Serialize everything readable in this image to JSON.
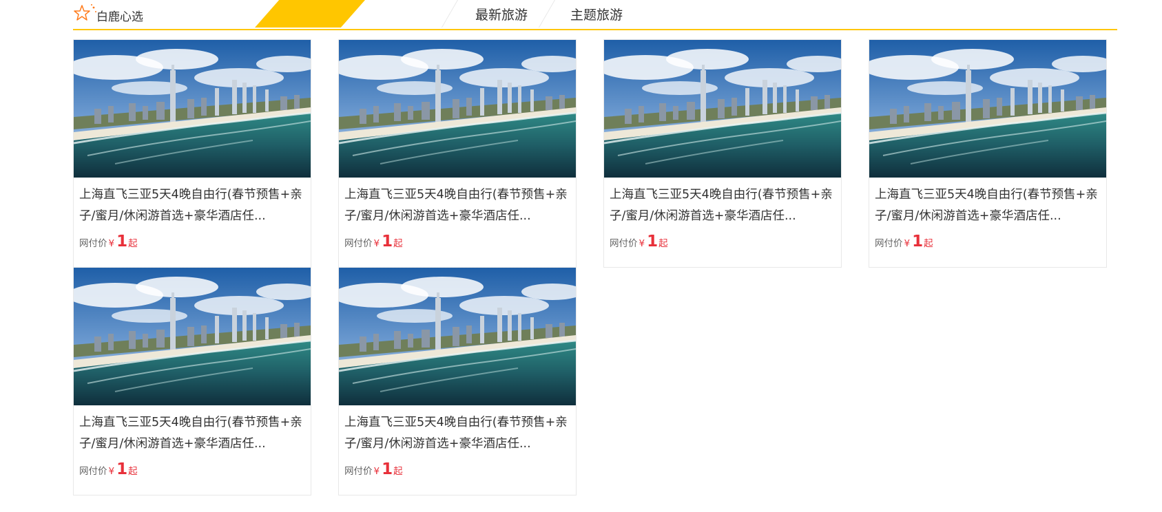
{
  "header": {
    "brand_label": "白鹿心选",
    "brand_icon": "star-outline-icon",
    "accent_color": "#ffc600",
    "tabs": [
      {
        "label": "最新旅游"
      },
      {
        "label": "主题旅游"
      }
    ]
  },
  "products": [
    {
      "title": "上海直飞三亚5天4晚自由行(春节预售+亲子/蜜月/休闲游首选+豪华酒店任...",
      "price_label": "网付价",
      "currency": "¥",
      "price": "1",
      "suffix": "起"
    },
    {
      "title": "上海直飞三亚5天4晚自由行(春节预售+亲子/蜜月/休闲游首选+豪华酒店任...",
      "price_label": "网付价",
      "currency": "¥",
      "price": "1",
      "suffix": "起"
    },
    {
      "title": "上海直飞三亚5天4晚自由行(春节预售+亲子/蜜月/休闲游首选+豪华酒店任...",
      "price_label": "网付价",
      "currency": "¥",
      "price": "1",
      "suffix": "起"
    },
    {
      "title": "上海直飞三亚5天4晚自由行(春节预售+亲子/蜜月/休闲游首选+豪华酒店任...",
      "price_label": "网付价",
      "currency": "¥",
      "price": "1",
      "suffix": "起"
    },
    {
      "title": "上海直飞三亚5天4晚自由行(春节预售+亲子/蜜月/休闲游首选+豪华酒店任...",
      "price_label": "网付价",
      "currency": "¥",
      "price": "1",
      "suffix": "起"
    },
    {
      "title": "上海直飞三亚5天4晚自由行(春节预售+亲子/蜜月/休闲游首选+豪华酒店任...",
      "price_label": "网付价",
      "currency": "¥",
      "price": "1",
      "suffix": "起"
    }
  ]
}
